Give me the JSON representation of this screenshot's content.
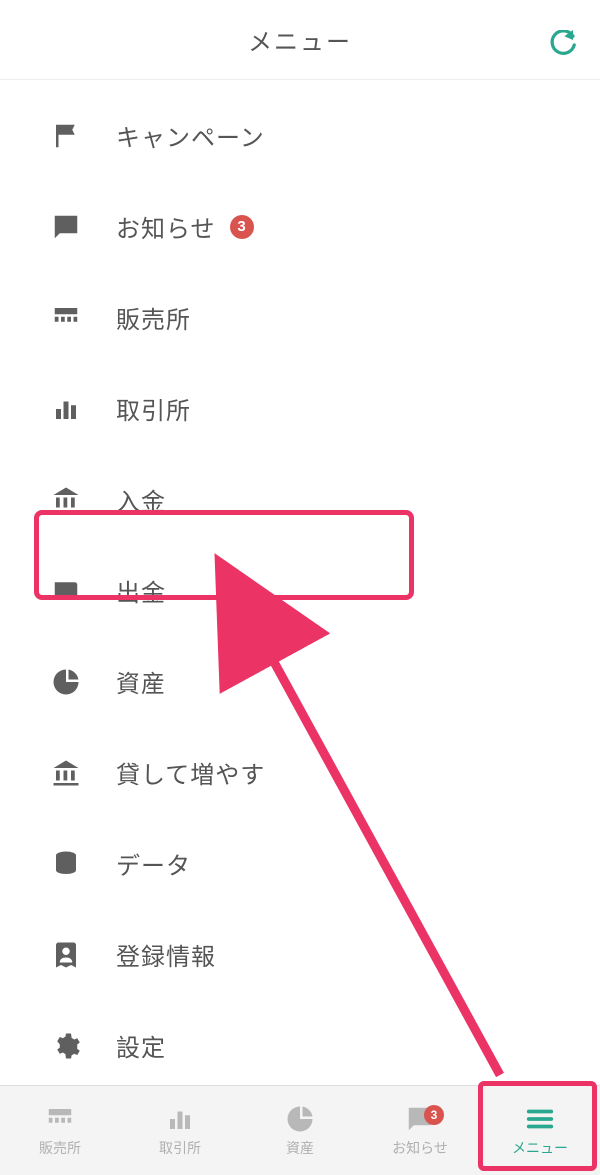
{
  "header": {
    "title": "メニュー"
  },
  "menu": {
    "items": [
      {
        "label": "キャンペーン",
        "icon": "flag-icon"
      },
      {
        "label": "お知らせ",
        "icon": "message-icon",
        "badge": "3"
      },
      {
        "label": "販売所",
        "icon": "store-icon"
      },
      {
        "label": "取引所",
        "icon": "bars-icon"
      },
      {
        "label": "入金",
        "icon": "bank-icon"
      },
      {
        "label": "出金",
        "icon": "wallet-icon"
      },
      {
        "label": "資産",
        "icon": "piechart-icon"
      },
      {
        "label": "貸して増やす",
        "icon": "bank-icon"
      },
      {
        "label": "データ",
        "icon": "stack-icon"
      },
      {
        "label": "登録情報",
        "icon": "idcard-icon"
      },
      {
        "label": "設定",
        "icon": "gear-icon"
      }
    ]
  },
  "tabs": {
    "items": [
      {
        "label": "販売所",
        "icon": "store-icon"
      },
      {
        "label": "取引所",
        "icon": "bars-icon"
      },
      {
        "label": "資産",
        "icon": "piechart-icon"
      },
      {
        "label": "お知らせ",
        "icon": "message-icon",
        "badge": "3"
      },
      {
        "label": "メニュー",
        "icon": "hamburger-icon",
        "active": true
      }
    ]
  }
}
